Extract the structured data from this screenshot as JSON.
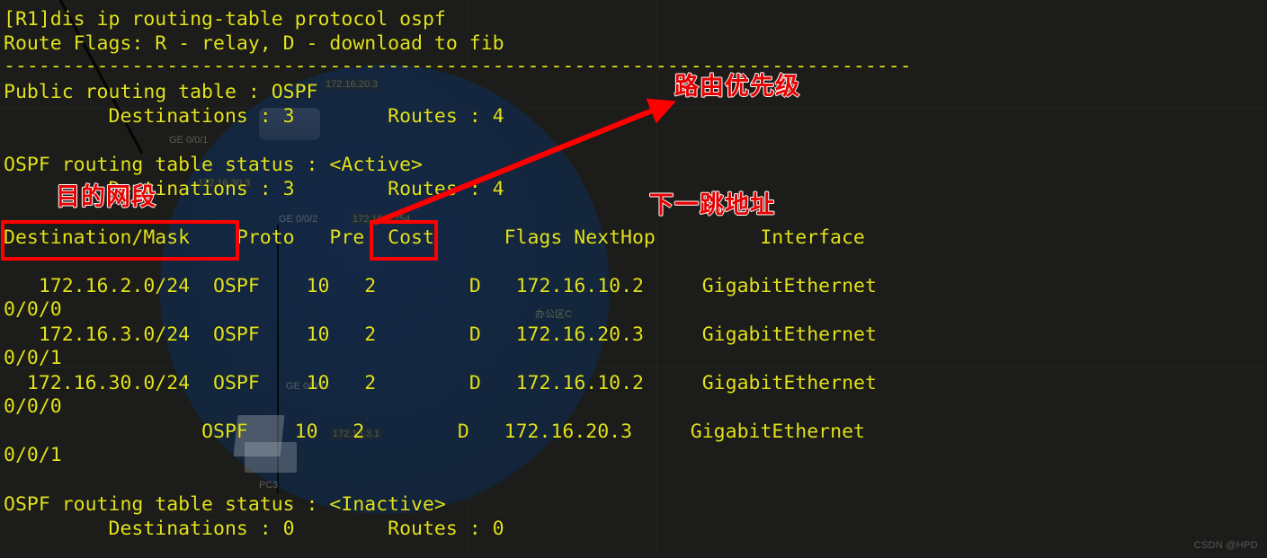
{
  "terminal": {
    "prompt_line": "[R1]dis ip routing-table protocol ospf",
    "flags_line": "Route Flags: R - relay, D - download to fib",
    "separator": "------------------------------------------------------------------------------",
    "public_table_line": "Public routing table : OSPF",
    "public_counts_line": "         Destinations : 3        Routes : 4",
    "active_status_line": "OSPF routing table status : <Active>",
    "active_counts_line": "         Destinations : 3        Routes : 4",
    "column_header_line": "Destination/Mask    Proto   Pre  Cost      Flags NextHop         Interface",
    "rows": [
      {
        "destination": "   172.16.2.0/24",
        "proto": "OSPF",
        "pre": "10",
        "cost": "2",
        "flags": "D",
        "nexthop": "172.16.10.2",
        "interface": "GigabitEthernet",
        "interface_cont": "0/0/0"
      },
      {
        "destination": "   172.16.3.0/24",
        "proto": "OSPF",
        "pre": "10",
        "cost": "2",
        "flags": "D",
        "nexthop": "172.16.20.3",
        "interface": "GigabitEthernet",
        "interface_cont": "0/0/1"
      },
      {
        "destination": "  172.16.30.0/24",
        "proto": "OSPF",
        "pre": "10",
        "cost": "2",
        "flags": "D",
        "nexthop": "172.16.10.2",
        "interface": "GigabitEthernet",
        "interface_cont": "0/0/0"
      },
      {
        "destination": "               ",
        "proto": "OSPF",
        "pre": "10",
        "cost": "2",
        "flags": "D",
        "nexthop": "172.16.20.3",
        "interface": "GigabitEthernet",
        "interface_cont": "0/0/1"
      }
    ],
    "inactive_status_line": "OSPF routing table status : <Inactive>",
    "inactive_counts_line": "         Destinations : 0        Routes : 0"
  },
  "annotations": {
    "color": "#e60000",
    "destination_label": "目的网段",
    "priority_label": "路由优先级",
    "nexthop_label": "下一跳地址"
  },
  "background": {
    "labels": [
      "GE 0/0/1",
      "GE 0/0/2",
      "GE 0/0/1",
      "PC3",
      "办公区C"
    ],
    "ip_labels": [
      "172.16.20.3",
      "172.16.30.3",
      "172.16.3.254",
      "172.16.3.1"
    ]
  },
  "watermark": "CSDN @HPD"
}
